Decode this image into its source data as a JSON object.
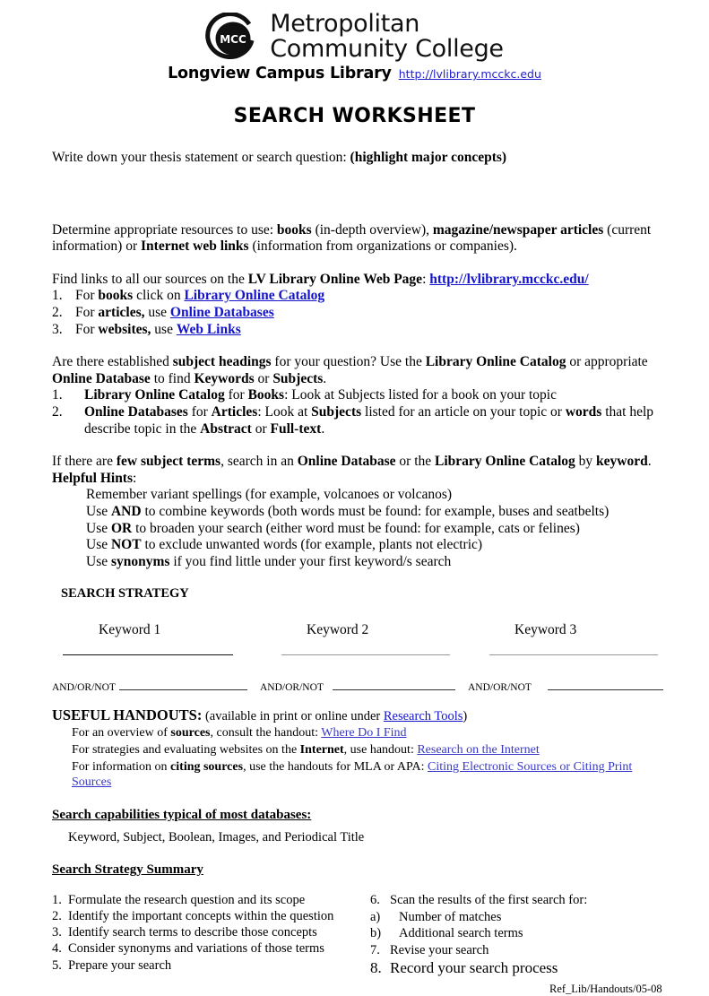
{
  "header": {
    "logo_alt": "MCC",
    "logo_text": "MCC",
    "wordmark_line1": "Metropolitan",
    "wordmark_line2": "Community College",
    "campus_name": "Longview Campus Library",
    "campus_url": "http://lvlibrary.mcckc.edu"
  },
  "title": "SEARCH WORKSHEET",
  "thesis": {
    "prompt": "Write down your thesis statement or search question:",
    "emphasis": "(highlight major concepts)"
  },
  "resources": {
    "lead": "Determine appropriate resources to use",
    "t1": ": ",
    "b1": "books",
    "t2": " (in-depth overview), ",
    "b2": "magazine/newspaper articles",
    "t3": " (current information) or ",
    "b3": "Internet web links",
    "t4": " (information from organizations or companies)."
  },
  "find_links": {
    "t1": "Find links to all our sources on the ",
    "b1": "LV Library Online Web Page",
    "t2": ": ",
    "link": "http://lvlibrary.mcckc.edu/",
    "items": [
      {
        "num": "1.",
        "pre": "For ",
        "bold": "books",
        "mid": " click on ",
        "link": "Library Online Catalog"
      },
      {
        "num": "2.",
        "pre": "For ",
        "bold": "articles,",
        "mid": " use ",
        "link": "Online Databases"
      },
      {
        "num": "3.",
        "pre": "For ",
        "bold": "websites,",
        "mid": " use ",
        "link": "Web Links"
      }
    ]
  },
  "subject_headings": {
    "t1": "Are there established ",
    "b1": "subject headings",
    "t2": " for your question?   Use the ",
    "b2": "Library Online Catalog",
    "t3": " or appropriate ",
    "b3": "Online Database",
    "t4": " to find ",
    "b4": "Keywords",
    "t5": " or ",
    "b5": "Subjects",
    "t6": ".",
    "item1": {
      "num": "1.",
      "bold": "Library Online Catalog",
      "mid": " for ",
      "bold2": "Books",
      "rest": ": Look at Subjects listed for a book on your topic"
    },
    "item2": {
      "num": "2.",
      "bold": "Online Databases",
      "mid": " for ",
      "bold2": "Articles",
      "rest1": ": Look at ",
      "bold3": "Subjects",
      "rest2": " listed for an article on your topic or ",
      "bold4": "words",
      "rest3": " that help describe topic in the ",
      "bold5": "Abstract",
      "rest4": " or ",
      "bold6": "Full-text",
      "rest5": "."
    }
  },
  "few_terms": {
    "t1": "If there are ",
    "b1": "few subject terms",
    "t2": ", search in an ",
    "b2": "Online Database",
    "t3": " or the ",
    "b3": "Library Online Catalog",
    "t4": " by ",
    "b4": "keyword",
    "t5": ".",
    "hints_label": "Helpful Hints",
    "hints_colon": ":",
    "hints": [
      {
        "pre": "Remember variant spellings (for example, volcanoes or volcanos)",
        "bold": "",
        "post": ""
      },
      {
        "pre": "Use ",
        "bold": "AND",
        "post": " to combine keywords (both words must be found: for example, buses and seatbelts)"
      },
      {
        "pre": "Use ",
        "bold": "OR",
        "post": " to broaden your search (either word must be found:  for example, cats or felines)"
      },
      {
        "pre": "Use ",
        "bold": "NOT",
        "post": " to exclude unwanted words (for example, plants not electric)"
      },
      {
        "pre": "Use ",
        "bold": "synonyms",
        "post": " if you find little under your first keyword/s search"
      }
    ]
  },
  "strategy": {
    "heading": "SEARCH STRATEGY",
    "keywords": [
      "Keyword 1",
      "Keyword 2",
      "Keyword 3"
    ],
    "andor_label": "AND/OR/NOT"
  },
  "handouts": {
    "heading": "USEFUL HANDOUTS:",
    "sub_pre": "  (available in print or online under ",
    "sub_link": "Research Tools",
    "sub_post": ")",
    "lines": [
      {
        "pre": "For an overview of ",
        "bold": "sources",
        "mid": ", consult the handout: ",
        "link": "Where Do I Find"
      },
      {
        "pre": "For strategies and evaluating websites on the ",
        "bold": "Internet",
        "mid": ", use handout: ",
        "link": "Research on the Internet"
      },
      {
        "pre": "For information on ",
        "bold": "citing sources",
        "mid": ", use the handouts for MLA or APA: ",
        "link": "Citing Electronic Sources or Citing Print Sources"
      }
    ]
  },
  "capabilities": {
    "heading": "Search capabilities typical of most databases:",
    "body": "Keyword, Subject, Boolean, Images, and Periodical Title"
  },
  "summary": {
    "heading": "Search Strategy Summary",
    "left": [
      {
        "num": "1.",
        "text": "Formulate the research question and its scope"
      },
      {
        "num": "2.",
        "text": "Identify the important concepts within the question"
      },
      {
        "num": "3.",
        "text": "Identify search terms to describe those concepts"
      },
      {
        "num": "4.",
        "text": "Consider synonyms and variations of those terms"
      },
      {
        "num": "5.",
        "text": "Prepare your search"
      }
    ],
    "right": [
      {
        "num": "6.",
        "text": "Scan the results of the first search for:"
      }
    ],
    "right_sub": [
      {
        "num": "a)",
        "text": "Number of matches"
      },
      {
        "num": "b)",
        "text": "Additional search terms"
      }
    ],
    "right_tail": [
      {
        "num": "7.",
        "text": "Revise your search"
      },
      {
        "num": "8.",
        "text": "Record your search process"
      }
    ]
  },
  "footer": "Ref_Lib/Handouts/05-08",
  "colors": {
    "link_blue": "#1414cc",
    "link_soft": "#3838c8",
    "text": "#000000"
  }
}
